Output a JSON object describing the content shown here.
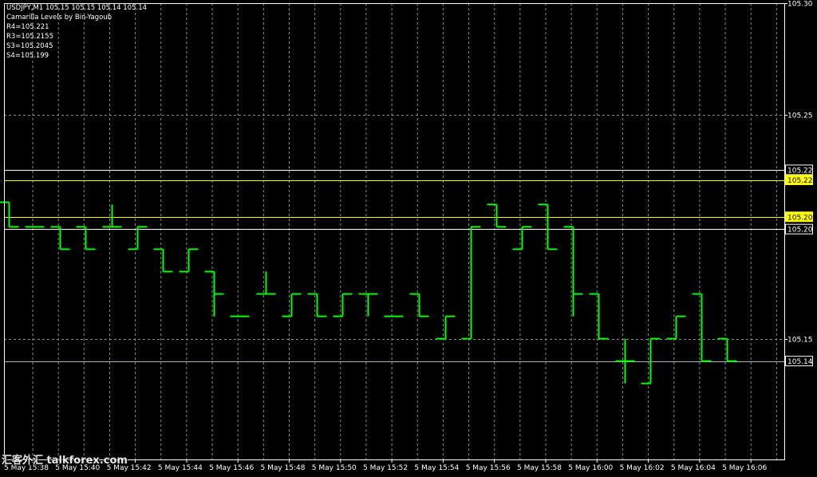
{
  "header": {
    "symbol_line": "USDJPY,M1  105.15 105.15 105.14 105.14",
    "indicator_name": "Camarilla Levels by Bin-Yagoub",
    "levels_text": [
      "R4=105.221",
      "R3=105.2155",
      "S3=105.2045",
      "S4=105.199"
    ]
  },
  "watermark": "汇客外汇 talkforex.com",
  "colors": {
    "background": "#000000",
    "candle": "#00ff00",
    "grid": "#8a8a8a",
    "frame": "#ffffff",
    "level_yellow": "#ffff00",
    "level_white": "#ffffff",
    "level_blue": "#9fb6cd",
    "axis_text": "#ffffff"
  },
  "chart_data": {
    "type": "bar",
    "title": "USDJPY,M1",
    "subtitle": "Camarilla Levels by Bin-Yagoub",
    "ylim": [
      105.096,
      105.3
    ],
    "y_ticks": [
      "105.30",
      "105.25",
      "105.15"
    ],
    "x_ticks": [
      "5 May 15:38",
      "5 May 15:40",
      "5 May 15:42",
      "5 May 15:44",
      "5 May 15:46",
      "5 May 15:48",
      "5 May 15:50",
      "5 May 15:52",
      "5 May 15:54",
      "5 May 15:56",
      "5 May 15:58",
      "5 May 16:00",
      "5 May 16:02",
      "5 May 16:04",
      "5 May 16:06"
    ],
    "grid": true,
    "price_levels": [
      {
        "label": "105.22",
        "value": 105.2255,
        "style": "white-line",
        "label_style": "black-bg"
      },
      {
        "label": "105.22",
        "value": 105.221,
        "style": "yellow-line",
        "label_style": "yellow-bg"
      },
      {
        "label": "105.20",
        "value": 105.2045,
        "style": "yellow-line",
        "label_style": "yellow-bg"
      },
      {
        "label": "105.20",
        "value": 105.199,
        "style": "white-line",
        "label_style": "black-bg"
      },
      {
        "label": "105.14",
        "value": 105.14,
        "style": "blue-line",
        "label_style": "black-bg"
      }
    ],
    "ohlc": [
      {
        "o": 105.211,
        "h": 105.211,
        "l": 105.2,
        "c": 105.2
      },
      {
        "o": 105.2,
        "h": 105.2,
        "l": 105.2,
        "c": 105.2
      },
      {
        "o": 105.2,
        "h": 105.2,
        "l": 105.19,
        "c": 105.19
      },
      {
        "o": 105.2,
        "h": 105.2,
        "l": 105.19,
        "c": 105.19
      },
      {
        "o": 105.2,
        "h": 105.21,
        "l": 105.2,
        "c": 105.2
      },
      {
        "o": 105.19,
        "h": 105.2,
        "l": 105.19,
        "c": 105.2
      },
      {
        "o": 105.19,
        "h": 105.19,
        "l": 105.18,
        "c": 105.18
      },
      {
        "o": 105.18,
        "h": 105.19,
        "l": 105.18,
        "c": 105.19
      },
      {
        "o": 105.18,
        "h": 105.18,
        "l": 105.16,
        "c": 105.17
      },
      {
        "o": 105.16,
        "h": 105.16,
        "l": 105.16,
        "c": 105.16
      },
      {
        "o": 105.17,
        "h": 105.18,
        "l": 105.17,
        "c": 105.17
      },
      {
        "o": 105.16,
        "h": 105.17,
        "l": 105.16,
        "c": 105.17
      },
      {
        "o": 105.17,
        "h": 105.17,
        "l": 105.16,
        "c": 105.16
      },
      {
        "o": 105.16,
        "h": 105.17,
        "l": 105.16,
        "c": 105.17
      },
      {
        "o": 105.17,
        "h": 105.17,
        "l": 105.16,
        "c": 105.17
      },
      {
        "o": 105.16,
        "h": 105.16,
        "l": 105.16,
        "c": 105.16
      },
      {
        "o": 105.17,
        "h": 105.17,
        "l": 105.16,
        "c": 105.16
      },
      {
        "o": 105.15,
        "h": 105.16,
        "l": 105.15,
        "c": 105.16
      },
      {
        "o": 105.15,
        "h": 105.2,
        "l": 105.15,
        "c": 105.2
      },
      {
        "o": 105.21,
        "h": 105.21,
        "l": 105.2,
        "c": 105.2
      },
      {
        "o": 105.19,
        "h": 105.2,
        "l": 105.19,
        "c": 105.2
      },
      {
        "o": 105.21,
        "h": 105.21,
        "l": 105.19,
        "c": 105.19
      },
      {
        "o": 105.2,
        "h": 105.2,
        "l": 105.16,
        "c": 105.17
      },
      {
        "o": 105.17,
        "h": 105.17,
        "l": 105.15,
        "c": 105.15
      },
      {
        "o": 105.14,
        "h": 105.15,
        "l": 105.13,
        "c": 105.14
      },
      {
        "o": 105.13,
        "h": 105.15,
        "l": 105.13,
        "c": 105.15
      },
      {
        "o": 105.15,
        "h": 105.16,
        "l": 105.15,
        "c": 105.16
      },
      {
        "o": 105.17,
        "h": 105.17,
        "l": 105.14,
        "c": 105.14
      },
      {
        "o": 105.15,
        "h": 105.15,
        "l": 105.14,
        "c": 105.14
      }
    ]
  }
}
